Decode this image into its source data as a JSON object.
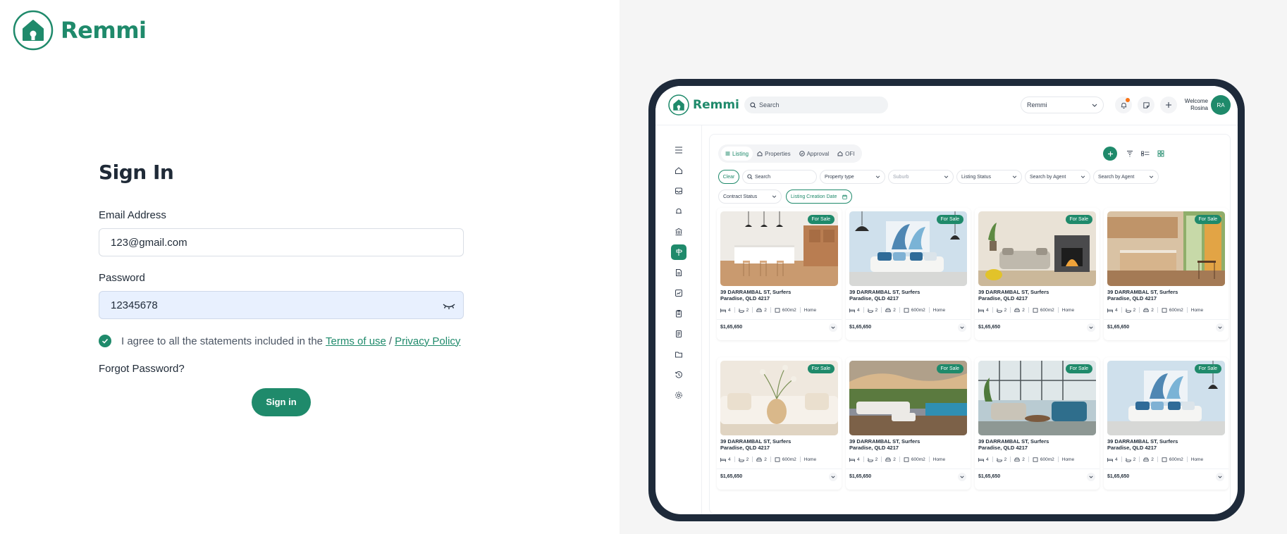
{
  "brand": {
    "name": "Remmi",
    "color": "#1f8a6b"
  },
  "signin": {
    "title": "Sign In",
    "email_label": "Email Address",
    "email_value": "123@gmail.com",
    "password_label": "Password",
    "password_value": "12345678",
    "agree_text": "I agree to all the statements included in the",
    "terms_link": "Terms of use",
    "separator": "/",
    "privacy_link": "Privacy Policy",
    "agree_checked": true,
    "forgot_label": "Forgot Password?",
    "submit_label": "Sign in"
  },
  "preview": {
    "search_placeholder": "Search",
    "org_select": "Remmi",
    "welcome_line1": "Welcome",
    "welcome_line2": "Rosina",
    "avatar_initials": "RA",
    "tabs": [
      "Listing",
      "Properties",
      "Approval",
      "OFI"
    ],
    "active_tab": "Listing",
    "filters": {
      "clear": "Clear",
      "search": "Search",
      "property_type": "Property type",
      "suburb": "Suburb",
      "listing_status": "Listing Status",
      "search_agent_1": "Search by Agent",
      "search_agent_2": "Search by Agent",
      "contract_status": "Contract Status",
      "creation_date": "Listing Creation Date"
    },
    "card": {
      "badge": "For Sale",
      "address_line1": "39 DARRAMBAL ST, Surfers",
      "address_line2": "Paradise, QLD 4217",
      "beds": "4",
      "baths": "2",
      "cars": "2",
      "area": "600m2",
      "type": "Home",
      "price": "$1,65,650"
    }
  }
}
